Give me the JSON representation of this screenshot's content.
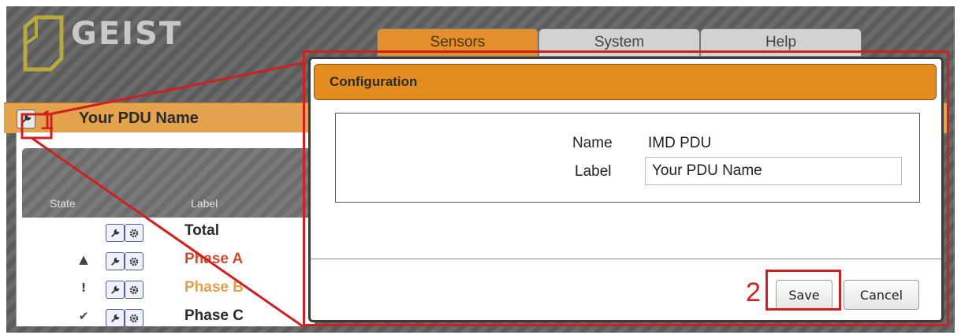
{
  "brand": {
    "name": "GEIST",
    "accent": "#e48c1e"
  },
  "tabs": [
    {
      "label": "Sensors",
      "active": true
    },
    {
      "label": "System",
      "active": false
    },
    {
      "label": "Help",
      "active": false
    }
  ],
  "pdu_section": {
    "title": "Your PDU Name"
  },
  "callouts": {
    "step1": "1",
    "step2": "2",
    "color": "#d12020"
  },
  "table": {
    "headers": {
      "state": "State",
      "label": "Label"
    },
    "rows": [
      {
        "state_icon": "",
        "label": "Total"
      },
      {
        "state_icon": "▲",
        "label": "Phase A"
      },
      {
        "state_icon": "!",
        "label": "Phase B"
      },
      {
        "state_icon": "✔",
        "label": "Phase C"
      }
    ]
  },
  "dialog": {
    "title": "Configuration",
    "name_label": "Name",
    "name_value": "IMD PDU",
    "label_label": "Label",
    "label_value": "Your PDU Name",
    "save": "Save",
    "cancel": "Cancel"
  },
  "icons": [
    "wrench-icon",
    "gear-icon",
    "alarm-triangle-icon",
    "warning-exclamation-icon",
    "checkmark-icon"
  ]
}
